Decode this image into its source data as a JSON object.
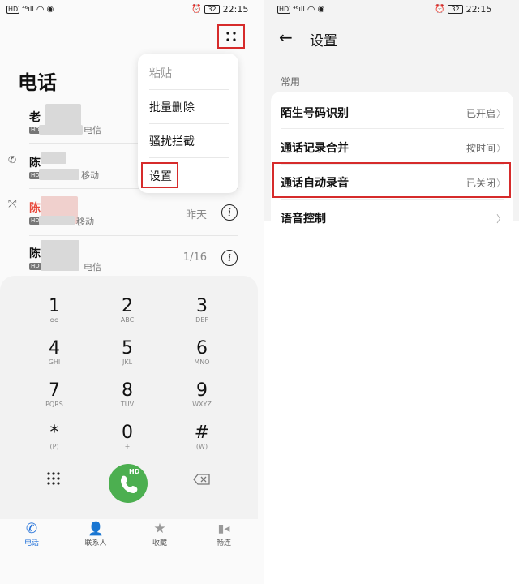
{
  "left": {
    "status": {
      "time": "22:15",
      "battery": "32"
    },
    "page_title": "电话",
    "calls": [
      {
        "name": "老",
        "carrier": "电信",
        "time": "",
        "red": false
      },
      {
        "name": "陈",
        "carrier": "移动",
        "time": "",
        "red": false
      },
      {
        "name": "陈",
        "carrier": "移动",
        "time": "昨天",
        "red": true
      },
      {
        "name": "陈",
        "carrier": "电信",
        "time": "1/16",
        "red": false
      }
    ],
    "menu": {
      "paste": "粘贴",
      "batch_delete": "批量删除",
      "harass_block": "骚扰拦截",
      "settings": "设置"
    },
    "keys": [
      {
        "num": "1",
        "sub": "ᴑᴑ"
      },
      {
        "num": "2",
        "sub": "ABC"
      },
      {
        "num": "3",
        "sub": "DEF"
      },
      {
        "num": "4",
        "sub": "GHI"
      },
      {
        "num": "5",
        "sub": "JKL"
      },
      {
        "num": "6",
        "sub": "MNO"
      },
      {
        "num": "7",
        "sub": "PQRS"
      },
      {
        "num": "8",
        "sub": "TUV"
      },
      {
        "num": "9",
        "sub": "WXYZ"
      },
      {
        "num": "*",
        "sub": "(P)"
      },
      {
        "num": "0",
        "sub": "+"
      },
      {
        "num": "#",
        "sub": "(W)"
      }
    ],
    "call_badge": "HD",
    "nav": {
      "phone": "电话",
      "contacts": "联系人",
      "favorites": "收藏",
      "changlian": "畅连"
    }
  },
  "right": {
    "status": {
      "time": "22:15",
      "battery": "32"
    },
    "title": "设置",
    "section": "常用",
    "rows": [
      {
        "label": "陌生号码识别",
        "value": "已开启"
      },
      {
        "label": "通话记录合并",
        "value": "按时间"
      },
      {
        "label": "通话自动录音",
        "value": "已关闭"
      },
      {
        "label": "语音控制",
        "value": ""
      }
    ]
  },
  "colors": {
    "highlight": "#d62b2b",
    "call_green": "#4caf50",
    "active_nav": "#1e6ed8",
    "missed_red": "#e8483b"
  }
}
